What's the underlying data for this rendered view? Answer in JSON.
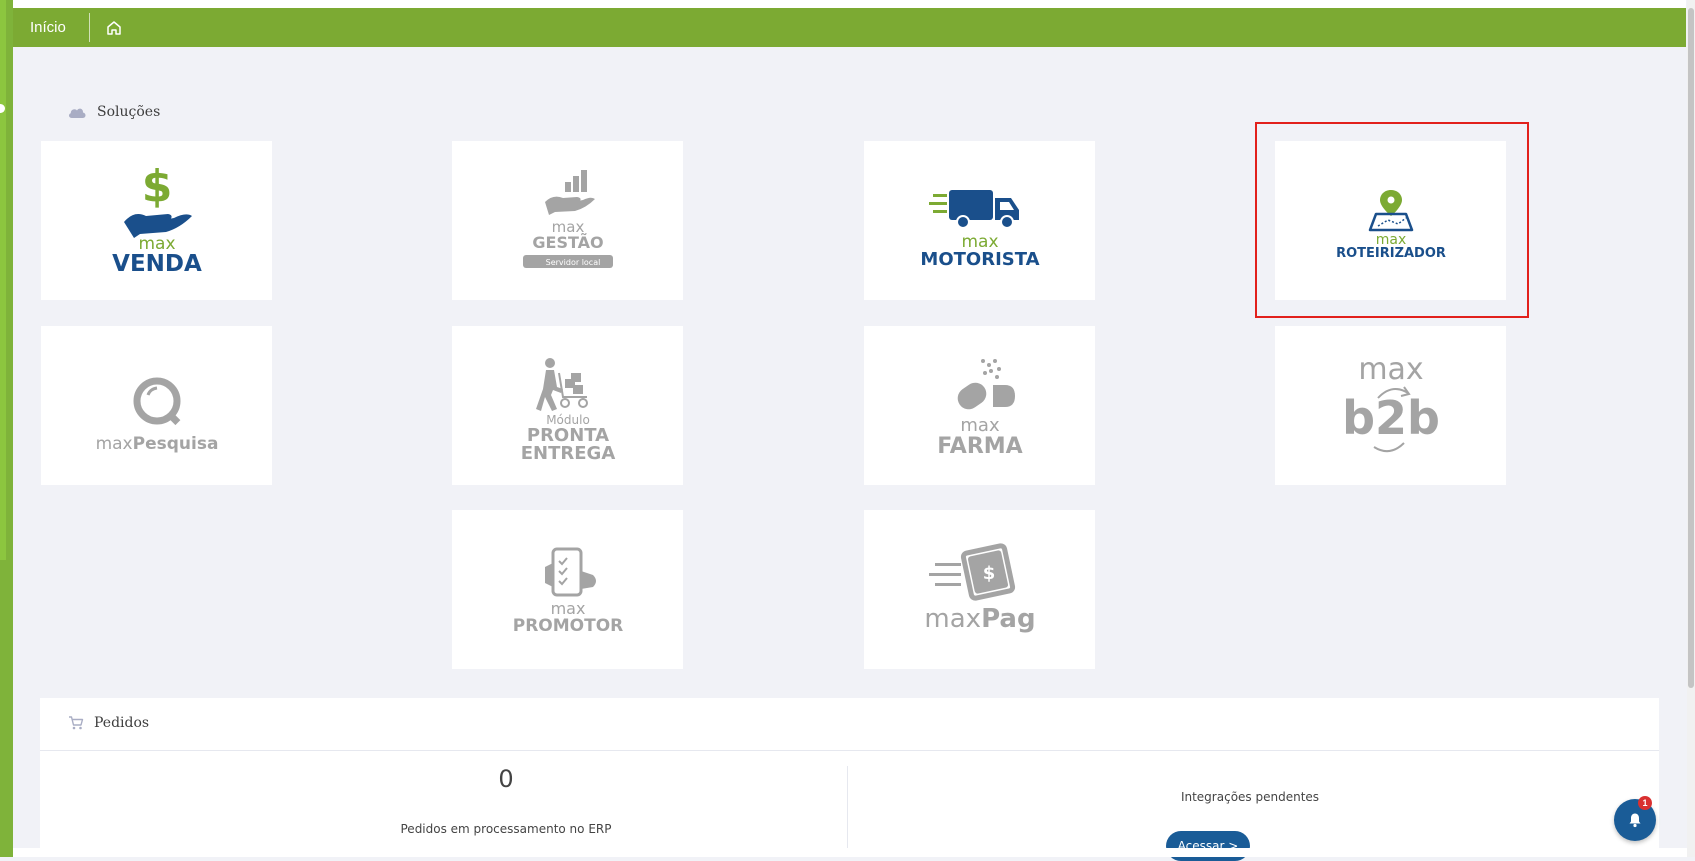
{
  "topbar": {
    "title": "Início"
  },
  "icons": {
    "home": "home-icon",
    "cloud": "cloud-icon",
    "cart": "cart-icon",
    "bell": "bell-icon"
  },
  "colors": {
    "brand_green": "#7caa33",
    "brand_blue": "#1a4f8b",
    "highlight_red": "#e2211c",
    "logo_gray": "#a4a4a4"
  },
  "solucoes": {
    "title": "Soluções",
    "cards": [
      {
        "id": "maxvenda",
        "line1": "max",
        "line2": "VENDA",
        "active": true
      },
      {
        "id": "maxgestao",
        "line1": "max",
        "line2": "GESTÃO",
        "tag": "Servidor local",
        "active": false
      },
      {
        "id": "maxmotorista",
        "line1": "max",
        "line2": "MOTORISTA",
        "active": true
      },
      {
        "id": "maxroteirizador",
        "line1": "max",
        "line2": "ROTEIRIZADOR",
        "active": true,
        "highlighted": true
      },
      {
        "id": "maxpesquisa",
        "line1": "max",
        "line2": "Pesquisa",
        "active": false
      },
      {
        "id": "prontaentrega",
        "line1": "Módulo",
        "line2": "PRONTA",
        "line3": "ENTREGA",
        "active": false
      },
      {
        "id": "maxfarma",
        "line1": "max",
        "line2": "FARMA",
        "active": false
      },
      {
        "id": "maxb2b",
        "line1": "max",
        "line2": "b2b",
        "active": false
      },
      {
        "id": "maxpromotor",
        "line1": "max",
        "line2": "PROMOTOR",
        "active": false
      },
      {
        "id": "maxpag",
        "line1": "max",
        "line2": "Pag",
        "active": false
      }
    ]
  },
  "pedidos": {
    "title": "Pedidos",
    "count": "0",
    "count_label": "Pedidos em processamento no ERP",
    "integrations_label": "Integrações pendentes",
    "access_button": "Acessar >"
  },
  "notifications": {
    "badge": "1"
  }
}
